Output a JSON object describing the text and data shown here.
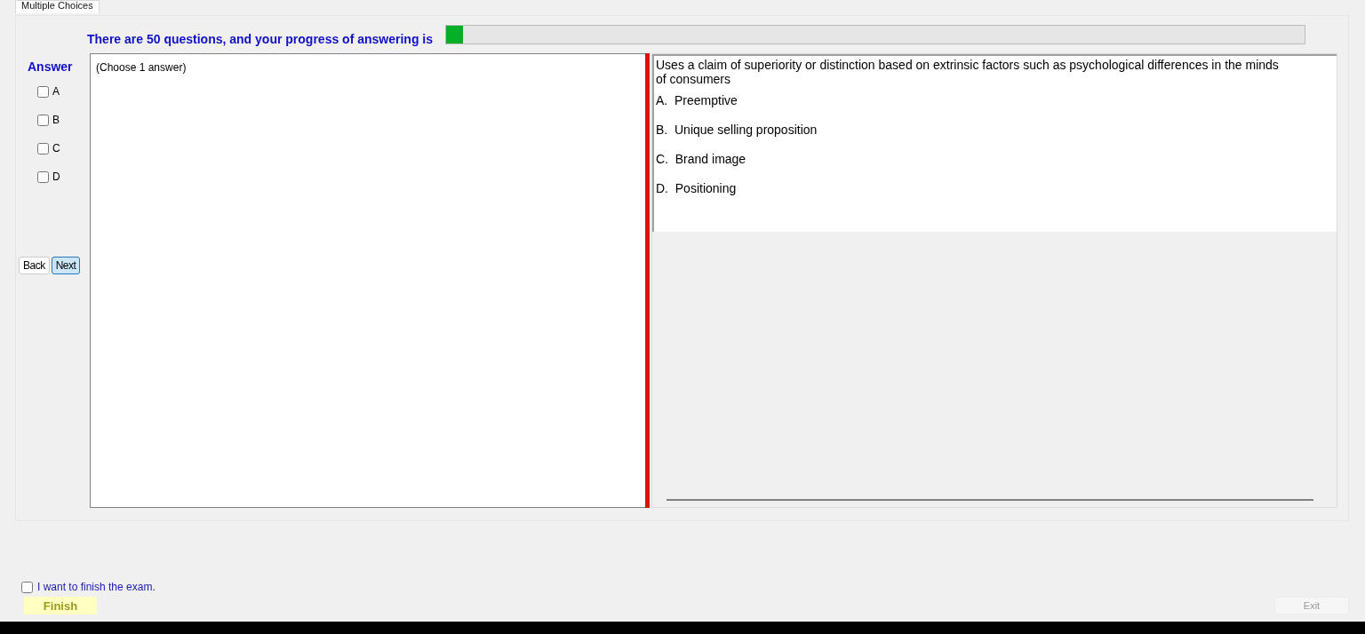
{
  "tab": {
    "label": "Multiple Choices",
    "selected": true
  },
  "heading": "There are 50 questions, and your progress of answering is",
  "progress": {
    "level": 0.02
  },
  "answer_label": "Answer",
  "answers": [
    {
      "label": "A",
      "checked": false
    },
    {
      "label": "B",
      "checked": false
    },
    {
      "label": "C",
      "checked": false
    },
    {
      "label": "D",
      "checked": false
    }
  ],
  "nav_buttons": [
    {
      "label": "Back",
      "selected": false
    },
    {
      "label": "Next",
      "selected": true
    }
  ],
  "answer_hint": "(Choose 1 answer)",
  "question": {
    "text": "Uses a claim of superiority or distinction based on extrinsic factors such as psychological differences in the minds of consumers",
    "options": [
      {
        "letter": "A.",
        "text": "Preemptive"
      },
      {
        "letter": "B.",
        "text": "Unique selling proposition"
      },
      {
        "letter": "C.",
        "text": "Brand image"
      },
      {
        "letter": "D.",
        "text": "Positioning"
      }
    ]
  },
  "finish_confirm": {
    "label": "I want to finish the exam.",
    "checked": false
  },
  "finish_button": "Finish",
  "exit_button": {
    "label": "Exit",
    "disabled": true
  }
}
